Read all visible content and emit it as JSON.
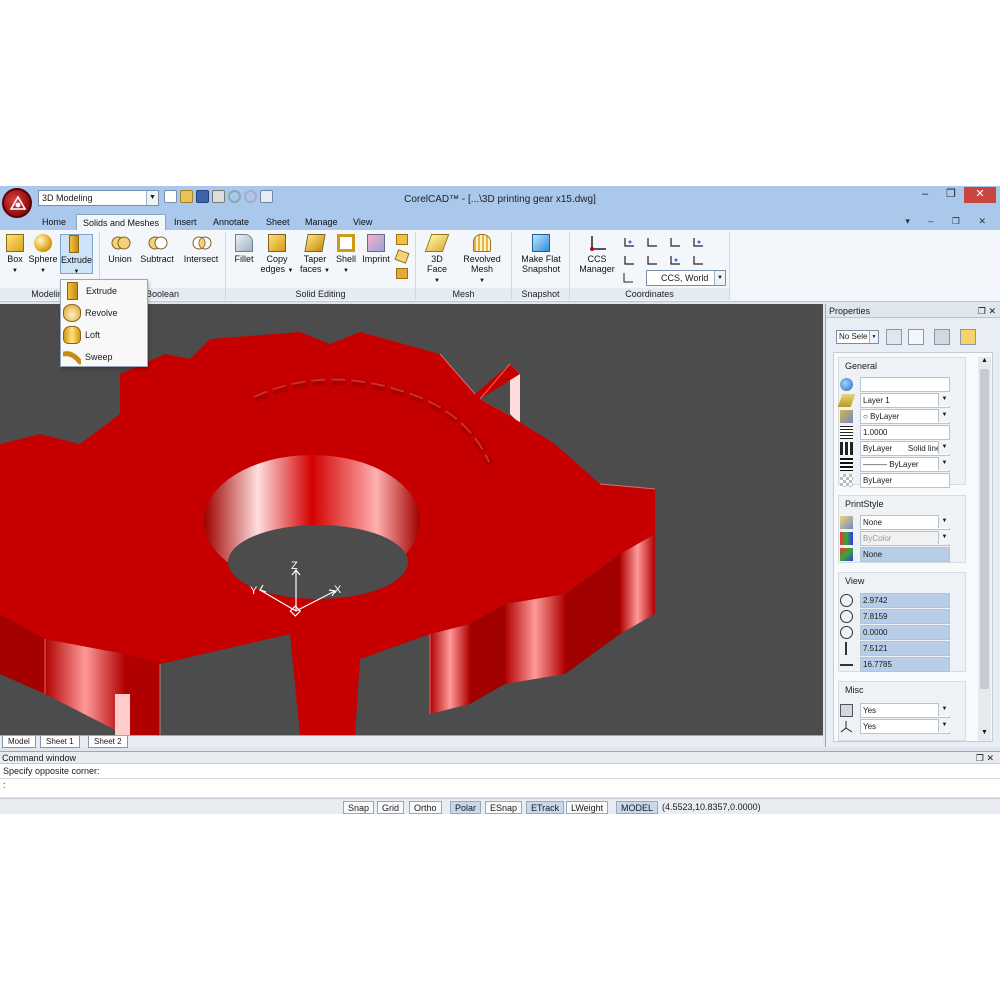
{
  "title_bar": {
    "workspace": "3D Modeling",
    "window_title": "CorelCAD™ - [...\\3D printing gear x15.dwg]",
    "controls": [
      "minimize",
      "maximize",
      "close"
    ]
  },
  "ribbon_tabs": [
    "Home",
    "Solids and Meshes",
    "Insert",
    "Annotate",
    "Sheet",
    "Manage",
    "View"
  ],
  "active_tab": "Solids and Meshes",
  "panels": {
    "modeling": {
      "label": "Modeling",
      "buttons": [
        "Box",
        "Sphere",
        "Extrude"
      ]
    },
    "boolean": {
      "label": "Boolean",
      "buttons": [
        "Union",
        "Subtract",
        "Intersect"
      ]
    },
    "solid_editing": {
      "label": "Solid Editing",
      "buttons": [
        "Fillet",
        "Copy edges",
        "Taper faces",
        "Shell",
        "Imprint"
      ]
    },
    "mesh": {
      "label": "Mesh",
      "buttons": [
        "3D Face",
        "Revolved Mesh"
      ]
    },
    "snapshot": {
      "label": "Snapshot",
      "buttons": [
        "Make Flat Snapshot"
      ]
    },
    "coordinates": {
      "label": "Coordinates",
      "buttons": [
        "CCS Manager"
      ],
      "ccs_value": "CCS, World"
    }
  },
  "dropdown_menu": [
    "Extrude",
    "Revolve",
    "Loft",
    "Sweep"
  ],
  "viewport": {
    "axis_labels": [
      "Z",
      "Y",
      "X"
    ]
  },
  "sheet_tabs": [
    "Model",
    "Sheet 1",
    "Sheet 2"
  ],
  "properties": {
    "title": "Properties",
    "selection": "No Sele",
    "sections": {
      "general": {
        "title": "General",
        "rows": [
          "",
          "Layer 1",
          "ByLayer",
          "1.0000",
          "ByLayer",
          "Solid line",
          "ByLayer",
          "ByLayer"
        ]
      },
      "printstyle": {
        "title": "PrintStyle",
        "rows": [
          "None",
          "ByColor",
          "None"
        ]
      },
      "view": {
        "title": "View",
        "rows": [
          "2.9742",
          "7.8159",
          "0.0000",
          "7.5121",
          "16.7785"
        ]
      },
      "misc": {
        "title": "Misc",
        "rows": [
          "Yes",
          "Yes"
        ]
      }
    }
  },
  "command_window": {
    "title": "Command window",
    "history": "Specify opposite corner:",
    "prompt": ":"
  },
  "status_bar": {
    "toggles": [
      "Snap",
      "Grid",
      "Ortho",
      "Polar",
      "ESnap",
      "ETrack",
      "LWeight",
      "MODEL"
    ],
    "coordinates": "(4.5523,10.8357,0.0000)"
  },
  "colors": {
    "title_bar": "#a9c8ec",
    "viewport_bg": "#4c4c4c",
    "gear_red": "#c40000",
    "selected_field": "#b7cde8"
  }
}
